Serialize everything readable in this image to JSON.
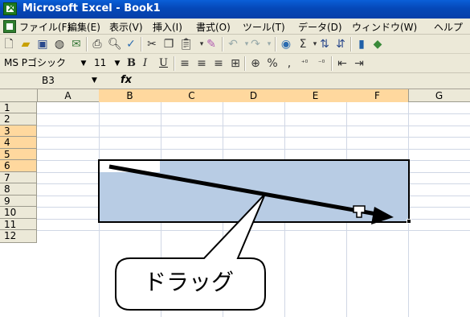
{
  "window": {
    "title": "Microsoft Excel - Book1"
  },
  "menu": {
    "items": [
      "ファイル(F)",
      "編集(E)",
      "表示(V)",
      "挿入(I)",
      "書式(O)",
      "ツール(T)",
      "データ(D)",
      "ウィンドウ(W)",
      "ヘルプ"
    ]
  },
  "format_toolbar": {
    "font_name": "MS Pゴシック",
    "font_size": "11",
    "bold_label": "B",
    "italic_label": "I",
    "underline_label": "U"
  },
  "formula_bar": {
    "name_box": "B3",
    "fx_label": "fx",
    "formula": ""
  },
  "sheet": {
    "columns": [
      "A",
      "B",
      "C",
      "D",
      "E",
      "F",
      "G"
    ],
    "rows": [
      "1",
      "2",
      "3",
      "4",
      "5",
      "6",
      "7",
      "8",
      "9",
      "10",
      "11",
      "12"
    ],
    "selected_range": "B3:F6"
  },
  "annotation": {
    "callout_text": "ドラッグ"
  },
  "colors": {
    "selection": "#b8cce4",
    "title_bar": "#0548b8",
    "header_highlight": "#ffd89e"
  }
}
